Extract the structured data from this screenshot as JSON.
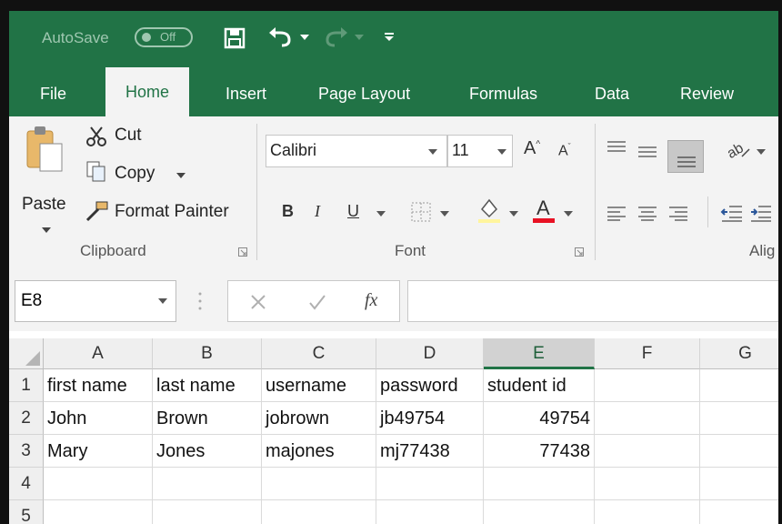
{
  "title_bar": {
    "autosave_label": "AutoSave",
    "autosave_state": "Off"
  },
  "tabs": [
    "File",
    "Home",
    "Insert",
    "Page Layout",
    "Formulas",
    "Data",
    "Review"
  ],
  "ribbon": {
    "clipboard": {
      "paste": "Paste",
      "cut": "Cut",
      "copy": "Copy",
      "format_painter": "Format Painter",
      "group_label": "Clipboard"
    },
    "font": {
      "font_name": "Calibri",
      "font_size": "11",
      "bold": "B",
      "italic": "I",
      "underline": "U",
      "group_label": "Font"
    },
    "alignment": {
      "group_label": "Alig"
    }
  },
  "formula_bar": {
    "name_box": "E8",
    "fx_label": "fx",
    "formula": ""
  },
  "sheet": {
    "columns": [
      "A",
      "B",
      "C",
      "D",
      "E",
      "F",
      "G"
    ],
    "selected_column": "E",
    "rows": [
      {
        "num": "1",
        "cells": [
          "first name",
          "last name",
          "username",
          "password",
          "student id"
        ]
      },
      {
        "num": "2",
        "cells": [
          "John",
          "Brown",
          "jobrown",
          "jb49754",
          "49754"
        ]
      },
      {
        "num": "3",
        "cells": [
          "Mary",
          "Jones",
          "majones",
          "mj77438",
          "77438"
        ]
      },
      {
        "num": "4",
        "cells": [
          "",
          "",
          "",
          "",
          ""
        ]
      },
      {
        "num": "5",
        "cells": [
          "",
          "",
          "",
          "",
          ""
        ]
      }
    ]
  },
  "colors": {
    "accent": "#217346",
    "font_color_underline": "#e81123"
  }
}
